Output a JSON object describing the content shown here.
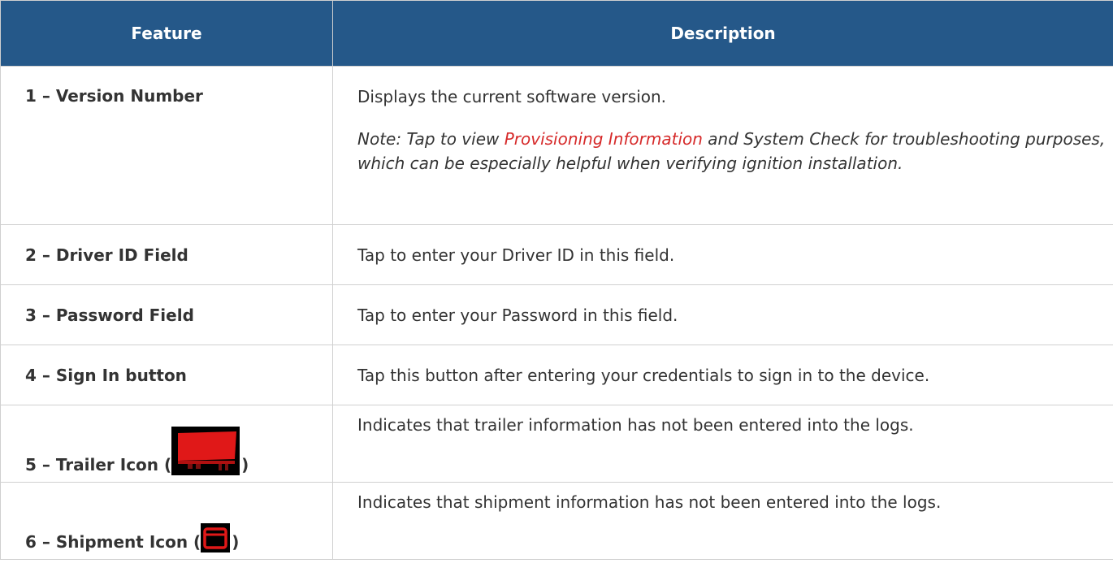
{
  "table": {
    "headers": [
      "Feature",
      "Description"
    ],
    "rows": [
      {
        "feature": "1 – Version Number",
        "description": "Displays the current software version.",
        "note_prefix": "Note: Tap to view ",
        "note_link": "Provisioning Information",
        "note_suffix": " and System Check for troubleshooting purposes, which can be especially helpful when verifying ignition installation."
      },
      {
        "feature": "2 – Driver ID Field",
        "description": "Tap to enter your Driver ID in this field."
      },
      {
        "feature": "3 – Password Field",
        "description": "Tap to enter your Password in this field."
      },
      {
        "feature": "4 – Sign In button",
        "description": "Tap this button after entering your credentials to sign in to the device."
      },
      {
        "feature_prefix": "5 – Trailer Icon (",
        "feature_suffix": ")",
        "icon": "trailer-icon",
        "description": "Indicates that trailer information has not been entered into the logs."
      },
      {
        "feature_prefix": "6 – Shipment Icon (",
        "feature_suffix": ")",
        "icon": "shipment-icon",
        "description": "Indicates that shipment information has not been entered into the logs."
      }
    ]
  },
  "colors": {
    "header_bg": "#255889",
    "header_text": "#ffffff",
    "link": "#d62a2a",
    "icon_red": "#e01818"
  }
}
